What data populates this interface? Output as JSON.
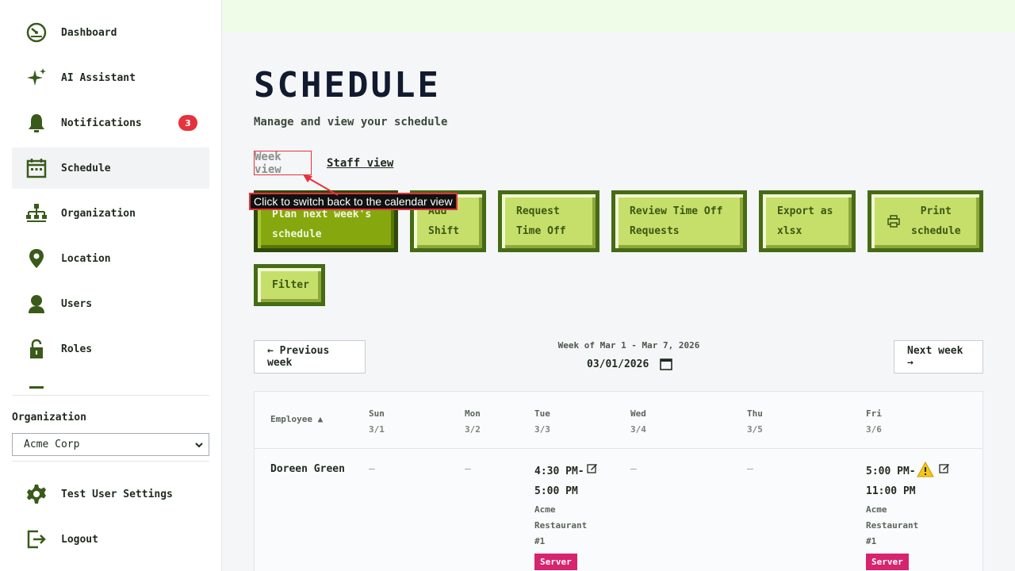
{
  "sidebar": {
    "items": [
      {
        "label": "Dashboard",
        "icon": "dashboard-icon"
      },
      {
        "label": "AI Assistant",
        "icon": "sparkle-icon"
      },
      {
        "label": "Notifications",
        "icon": "bell-icon",
        "badge": "3"
      },
      {
        "label": "Schedule",
        "icon": "calendar-icon",
        "active": true
      },
      {
        "label": "Organization",
        "icon": "org-chart-icon"
      },
      {
        "label": "Location",
        "icon": "location-pin-icon"
      },
      {
        "label": "Users",
        "icon": "user-icon"
      },
      {
        "label": "Roles",
        "icon": "lock-icon"
      }
    ],
    "org_label": "Organization",
    "org_selected": "Acme Corp",
    "bottom_items": [
      {
        "label": "Test User Settings",
        "icon": "gear-icon"
      },
      {
        "label": "Logout",
        "icon": "logout-icon"
      }
    ]
  },
  "page": {
    "title": "SCHEDULE",
    "subtitle": "Manage and view your schedule"
  },
  "views": {
    "week": "Week view",
    "staff": "Staff view"
  },
  "tooltip": "Click to switch back to the calendar view",
  "actions": {
    "plan": [
      "Plan next week's",
      "schedule"
    ],
    "add": [
      "Add",
      "Shift"
    ],
    "request": [
      "Request",
      "Time Off"
    ],
    "review": [
      "Review Time Off",
      "Requests"
    ],
    "export": [
      "Export as",
      "xlsx"
    ],
    "print": [
      "Print",
      "schedule"
    ],
    "filter": "Filter"
  },
  "week_nav": {
    "prev": "← Previous week",
    "next": "Next week →",
    "label": "Week of Mar 1 - Mar 7, 2026",
    "date": "03/01/2026"
  },
  "table": {
    "employee_header": "Employee ▲",
    "days": [
      {
        "name": "Sun",
        "date": "3/1"
      },
      {
        "name": "Mon",
        "date": "3/2"
      },
      {
        "name": "Tue",
        "date": "3/3"
      },
      {
        "name": "Wed",
        "date": "3/4"
      },
      {
        "name": "Thu",
        "date": "3/5"
      },
      {
        "name": "Fri",
        "date": "3/6"
      }
    ],
    "rows": [
      {
        "employee": "Doreen Green",
        "empty": "–",
        "tue": {
          "time1": "4:30 PM-",
          "time2": "5:00 PM",
          "loc": [
            "Acme",
            "Restaurant",
            "#1"
          ],
          "role": "Server"
        },
        "fri": {
          "time1": "5:00 PM-",
          "time2": "11:00 PM",
          "loc": [
            "Acme",
            "Restaurant",
            "#1"
          ],
          "role": "Server"
        }
      }
    ]
  },
  "colors": {
    "accent_green": "#86a80e",
    "button_green": "#c6df6a",
    "badge_red": "#e5323b",
    "role_magenta": "#d6246e"
  }
}
